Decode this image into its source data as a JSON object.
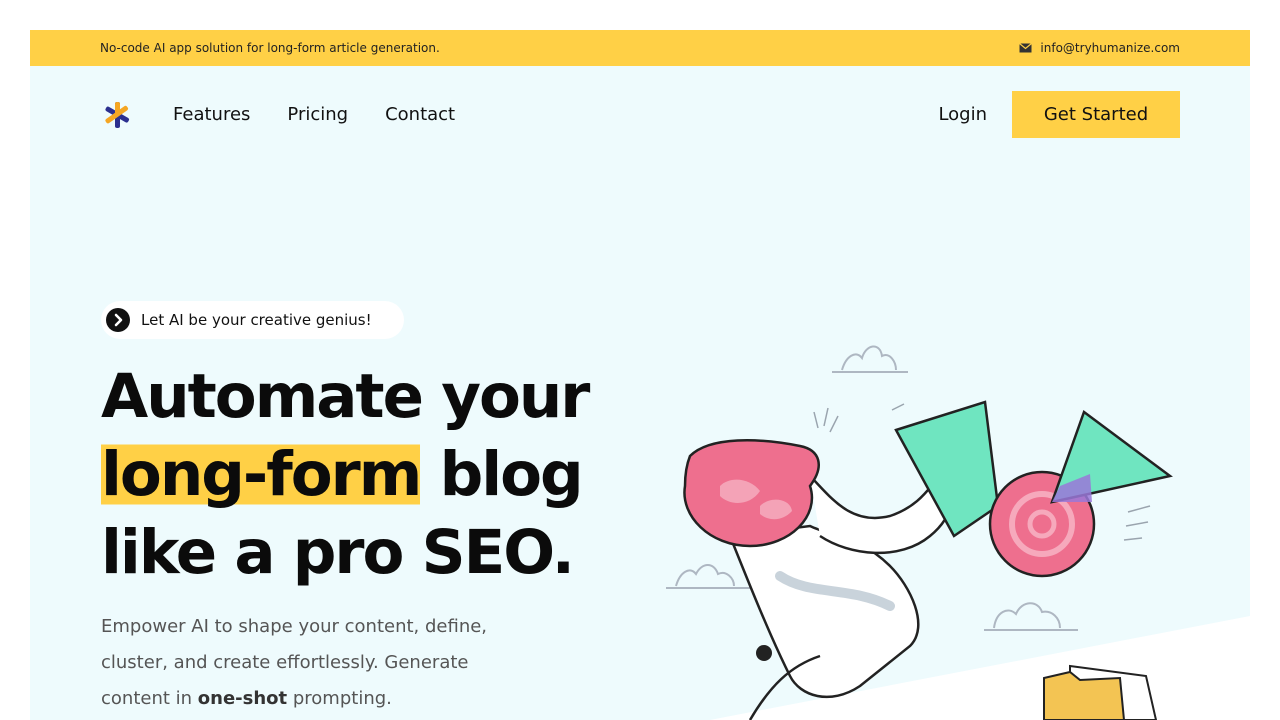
{
  "topbar": {
    "tagline": "No-code AI app solution for long-form article generation.",
    "email": "info@tryhumanize.com"
  },
  "nav": {
    "links": [
      "Features",
      "Pricing",
      "Contact"
    ],
    "login": "Login",
    "cta": "Get Started"
  },
  "hero": {
    "badge": "Let AI be your creative genius!",
    "headline": {
      "line1": "Automate your",
      "highlight": "long-form",
      "line2_rest": " blog",
      "line3": "like a pro SEO."
    },
    "lead": {
      "part1": "Empower AI to shape your content, define, cluster, and create effortlessly. Generate content in ",
      "bold": "one-shot",
      "part2": " prompting."
    }
  },
  "colors": {
    "accent": "#ffd046",
    "hero_bg": "#eefbfd",
    "logo_blue": "#2b2f8f",
    "logo_orange": "#f5a623"
  }
}
